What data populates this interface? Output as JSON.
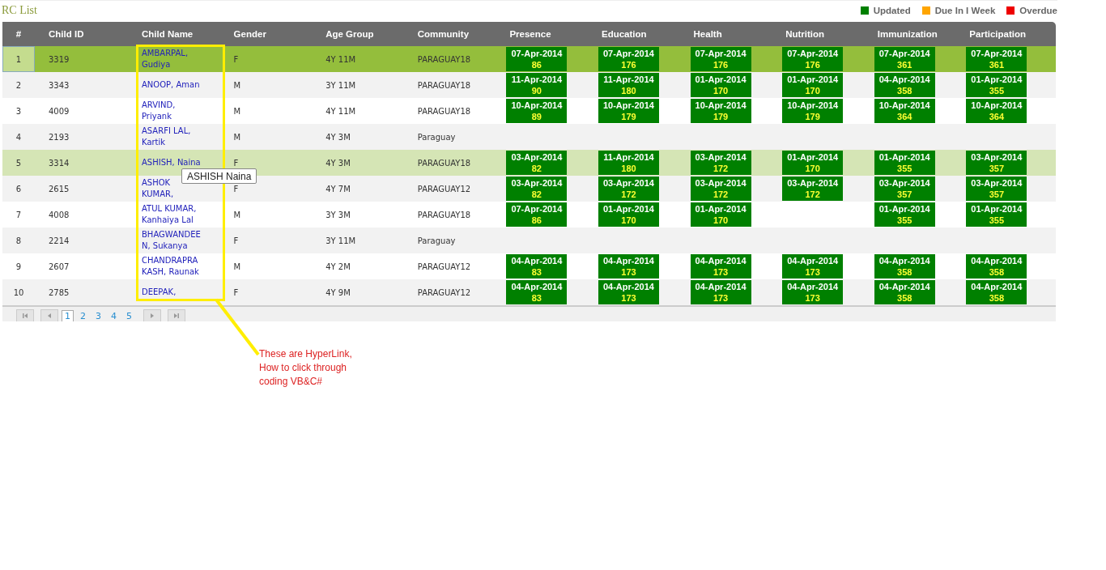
{
  "title": "RC List",
  "legend": [
    {
      "label": "Updated",
      "color": "#008000"
    },
    {
      "label": "Due In I Week",
      "color": "#ffa500"
    },
    {
      "label": "Overdue",
      "color": "#ee0000"
    }
  ],
  "table": {
    "columns": [
      "#",
      "Child ID",
      "Child Name",
      "Gender",
      "Age Group",
      "Community",
      "Presence",
      "Education",
      "Health",
      "Nutrition",
      "Immunization",
      "Participation"
    ],
    "rows": [
      {
        "no": "1",
        "id": "3319",
        "name": "AMBARPAL, Gudiya",
        "gender": "F",
        "age": "4Y 11M",
        "community": "PARAGUAY18",
        "selected": true,
        "hovered": false,
        "status": [
          {
            "date": "07-Apr-2014",
            "count": "86"
          },
          {
            "date": "07-Apr-2014",
            "count": "176"
          },
          {
            "date": "07-Apr-2014",
            "count": "176"
          },
          {
            "date": "07-Apr-2014",
            "count": "176"
          },
          {
            "date": "07-Apr-2014",
            "count": "361"
          },
          {
            "date": "07-Apr-2014",
            "count": "361"
          }
        ]
      },
      {
        "no": "2",
        "id": "3343",
        "name": "ANOOP, Aman",
        "gender": "M",
        "age": "3Y 11M",
        "community": "PARAGUAY18",
        "selected": false,
        "hovered": false,
        "status": [
          {
            "date": "11-Apr-2014",
            "count": "90"
          },
          {
            "date": "11-Apr-2014",
            "count": "180"
          },
          {
            "date": "01-Apr-2014",
            "count": "170"
          },
          {
            "date": "01-Apr-2014",
            "count": "170"
          },
          {
            "date": "04-Apr-2014",
            "count": "358"
          },
          {
            "date": "01-Apr-2014",
            "count": "355"
          }
        ]
      },
      {
        "no": "3",
        "id": "4009",
        "name": "ARVIND, Priyank",
        "gender": "M",
        "age": "4Y 11M",
        "community": "PARAGUAY18",
        "selected": false,
        "hovered": false,
        "status": [
          {
            "date": "10-Apr-2014",
            "count": "89"
          },
          {
            "date": "10-Apr-2014",
            "count": "179"
          },
          {
            "date": "10-Apr-2014",
            "count": "179"
          },
          {
            "date": "10-Apr-2014",
            "count": "179"
          },
          {
            "date": "10-Apr-2014",
            "count": "364"
          },
          {
            "date": "10-Apr-2014",
            "count": "364"
          }
        ]
      },
      {
        "no": "4",
        "id": "2193",
        "name": "ASARFI LAL, Kartik",
        "gender": "M",
        "age": "4Y 3M",
        "community": "Paraguay",
        "selected": false,
        "hovered": false,
        "status": [
          {
            "kind": "empty"
          },
          {
            "kind": "empty"
          },
          {
            "kind": "empty"
          },
          {
            "kind": "empty"
          },
          {
            "kind": "empty"
          },
          {
            "kind": "empty"
          }
        ]
      },
      {
        "no": "5",
        "id": "3314",
        "name": "ASHISH, Naina",
        "gender": "F",
        "age": "4Y 3M",
        "community": "PARAGUAY18",
        "selected": false,
        "hovered": true,
        "status": [
          {
            "date": "03-Apr-2014",
            "count": "82"
          },
          {
            "date": "11-Apr-2014",
            "count": "180"
          },
          {
            "date": "03-Apr-2014",
            "count": "172"
          },
          {
            "date": "01-Apr-2014",
            "count": "170"
          },
          {
            "date": "01-Apr-2014",
            "count": "355"
          },
          {
            "date": "03-Apr-2014",
            "count": "357"
          }
        ]
      },
      {
        "no": "6",
        "id": "2615",
        "name": "ASHOK KUMAR,",
        "gender": "F",
        "age": "4Y 7M",
        "community": "PARAGUAY12",
        "selected": false,
        "hovered": false,
        "status": [
          {
            "date": "03-Apr-2014",
            "count": "82"
          },
          {
            "date": "03-Apr-2014",
            "count": "172"
          },
          {
            "date": "03-Apr-2014",
            "count": "172"
          },
          {
            "date": "03-Apr-2014",
            "count": "172"
          },
          {
            "date": "03-Apr-2014",
            "count": "357"
          },
          {
            "date": "03-Apr-2014",
            "count": "357"
          }
        ]
      },
      {
        "no": "7",
        "id": "4008",
        "name": "ATUL KUMAR, Kanhaiya Lal",
        "gender": "M",
        "age": "3Y 3M",
        "community": "PARAGUAY18",
        "selected": false,
        "hovered": false,
        "status": [
          {
            "date": "07-Apr-2014",
            "count": "86"
          },
          {
            "date": "01-Apr-2014",
            "count": "170"
          },
          {
            "date": "01-Apr-2014",
            "count": "170"
          },
          {
            "kind": "empty"
          },
          {
            "date": "01-Apr-2014",
            "count": "355"
          },
          {
            "date": "01-Apr-2014",
            "count": "355"
          }
        ]
      },
      {
        "no": "8",
        "id": "2214",
        "name": "BHAGWANDEEN, Sukanya",
        "gender": "F",
        "age": "3Y 11M",
        "community": "Paraguay",
        "selected": false,
        "hovered": false,
        "status": [
          {
            "kind": "empty"
          },
          {
            "kind": "empty"
          },
          {
            "kind": "empty"
          },
          {
            "kind": "empty"
          },
          {
            "kind": "empty"
          },
          {
            "kind": "empty"
          }
        ]
      },
      {
        "no": "9",
        "id": "2607",
        "name": "CHANDRAPRAKASH, Raunak",
        "gender": "M",
        "age": "4Y 2M",
        "community": "PARAGUAY12",
        "selected": false,
        "hovered": false,
        "status": [
          {
            "date": "04-Apr-2014",
            "count": "83"
          },
          {
            "date": "04-Apr-2014",
            "count": "173"
          },
          {
            "date": "04-Apr-2014",
            "count": "173"
          },
          {
            "date": "04-Apr-2014",
            "count": "173"
          },
          {
            "date": "04-Apr-2014",
            "count": "358"
          },
          {
            "date": "04-Apr-2014",
            "count": "358"
          }
        ]
      },
      {
        "no": "10",
        "id": "2785",
        "name": "DEEPAK,",
        "gender": "F",
        "age": "4Y 9M",
        "community": "PARAGUAY12",
        "selected": false,
        "hovered": false,
        "status": [
          {
            "date": "04-Apr-2014",
            "count": "83"
          },
          {
            "date": "04-Apr-2014",
            "count": "173"
          },
          {
            "date": "04-Apr-2014",
            "count": "173"
          },
          {
            "date": "04-Apr-2014",
            "count": "173"
          },
          {
            "date": "04-Apr-2014",
            "count": "358"
          },
          {
            "date": "04-Apr-2014",
            "count": "358"
          }
        ]
      }
    ]
  },
  "pager": {
    "pages": [
      {
        "label": "1",
        "selected": true
      },
      {
        "label": "2",
        "selected": false
      },
      {
        "label": "3",
        "selected": false
      },
      {
        "label": "4",
        "selected": false
      },
      {
        "label": "5",
        "selected": false
      }
    ]
  },
  "tooltip": "ASHISH Naina",
  "annotation": "These are HyperLink, How to click through coding VB&C#"
}
